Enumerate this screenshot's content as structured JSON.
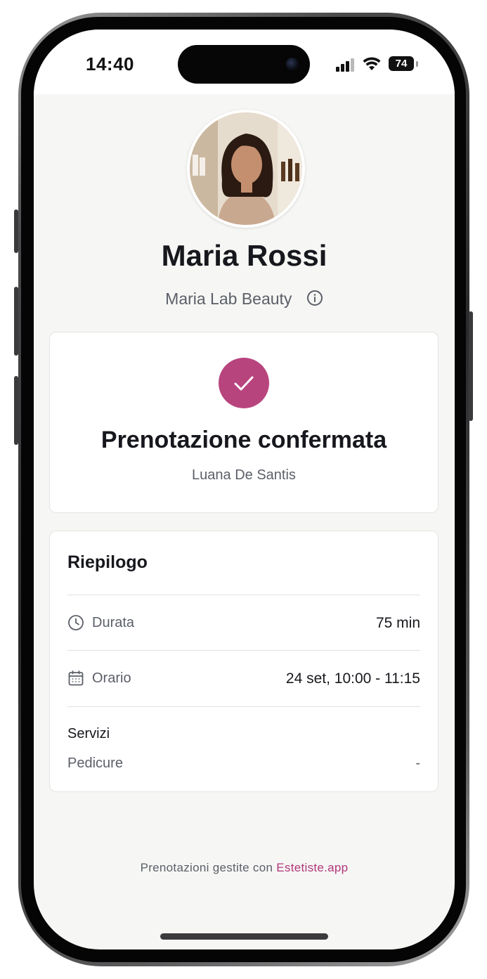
{
  "status_bar": {
    "time": "14:40",
    "battery": "74",
    "icons": [
      "signal-icon",
      "wifi-icon",
      "battery-icon"
    ]
  },
  "profile": {
    "avatar": "avatar-photo",
    "name": "Maria Rossi",
    "business": "Maria Lab Beauty",
    "info_icon": "info-icon"
  },
  "confirmation": {
    "icon": "check-icon",
    "title": "Prenotazione confermata",
    "customer": "Luana De Santis"
  },
  "summary": {
    "title": "Riepilogo",
    "rows": [
      {
        "icon": "clock-icon",
        "label": "Durata",
        "value": "75 min"
      },
      {
        "icon": "calendar-icon",
        "label": "Orario",
        "value": "24 set, 10:00 - 11:15"
      }
    ],
    "services_title": "Servizi",
    "services": [
      {
        "name": "Pedicure",
        "price": "-"
      }
    ]
  },
  "footer": {
    "text": "Prenotazioni gestite con",
    "brand": "Estetiste.app"
  },
  "colors": {
    "accent": "#b8447e",
    "brand_link": "#b0377a",
    "background": "#f6f6f4",
    "text_primary": "#17181d",
    "text_secondary": "#5b5f68"
  }
}
